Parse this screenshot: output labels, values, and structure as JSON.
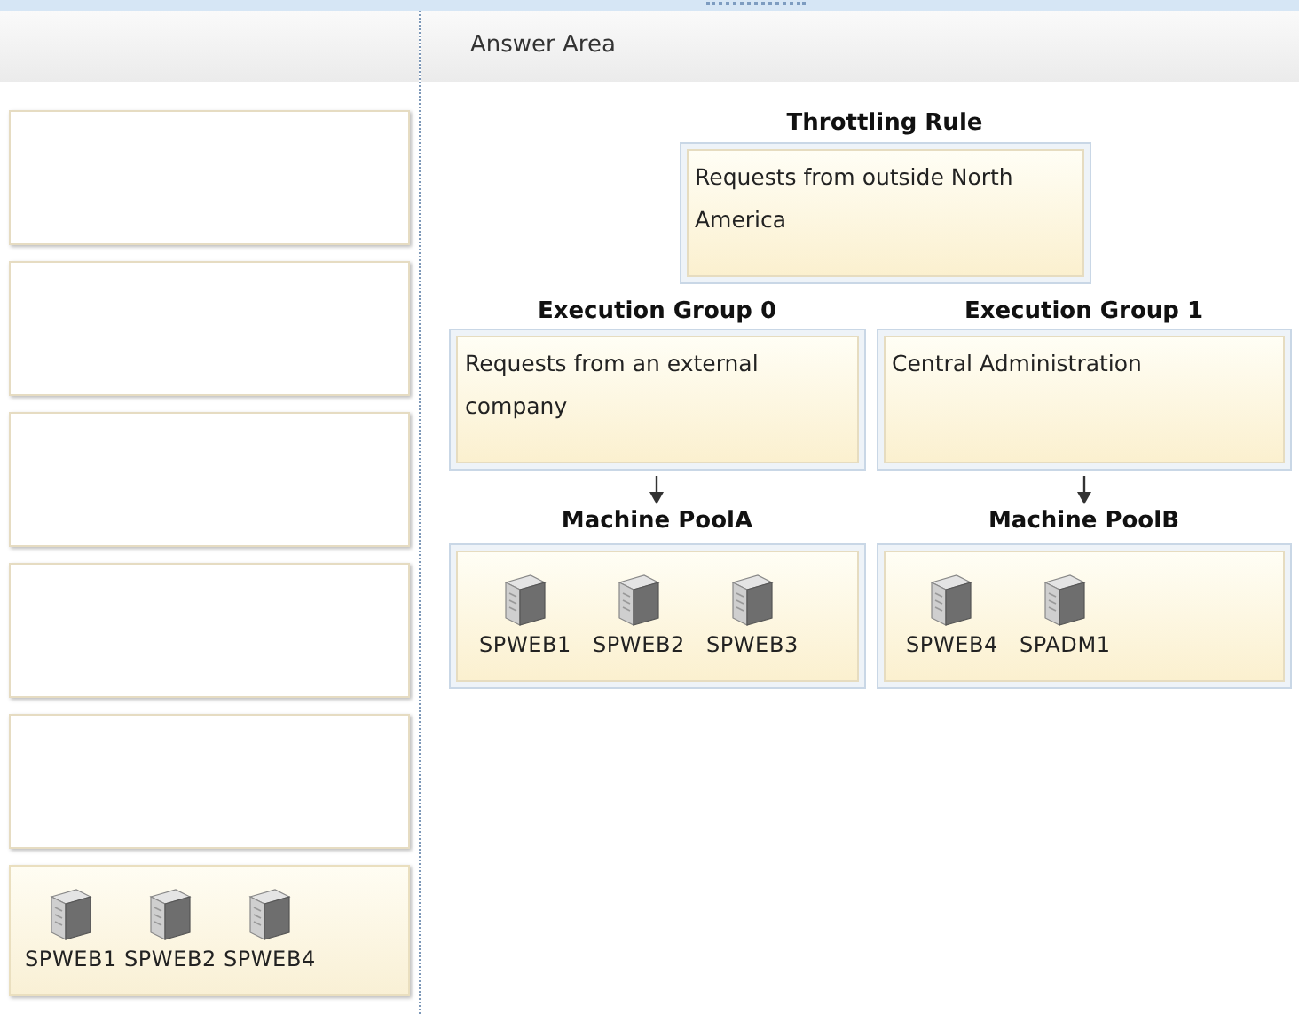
{
  "answer_area": {
    "title": "Answer Area"
  },
  "source_items": [
    {
      "kind": "empty"
    },
    {
      "kind": "empty"
    },
    {
      "kind": "empty"
    },
    {
      "kind": "empty"
    },
    {
      "kind": "empty"
    },
    {
      "kind": "servers",
      "servers": [
        "SPWEB1",
        "SPWEB2",
        "SPWEB4"
      ]
    }
  ],
  "throttling_rule": {
    "title": "Throttling Rule",
    "text": "Requests from outside North America"
  },
  "execution_groups": [
    {
      "title": "Execution Group 0",
      "text": "Requests from an external company",
      "pool": {
        "title": "Machine PoolA",
        "servers": [
          "SPWEB1",
          "SPWEB2",
          "SPWEB3"
        ]
      }
    },
    {
      "title": "Execution Group 1",
      "text": "Central Administration",
      "pool": {
        "title": "Machine PoolB",
        "servers": [
          "SPWEB4",
          "SPADM1"
        ]
      }
    }
  ]
}
